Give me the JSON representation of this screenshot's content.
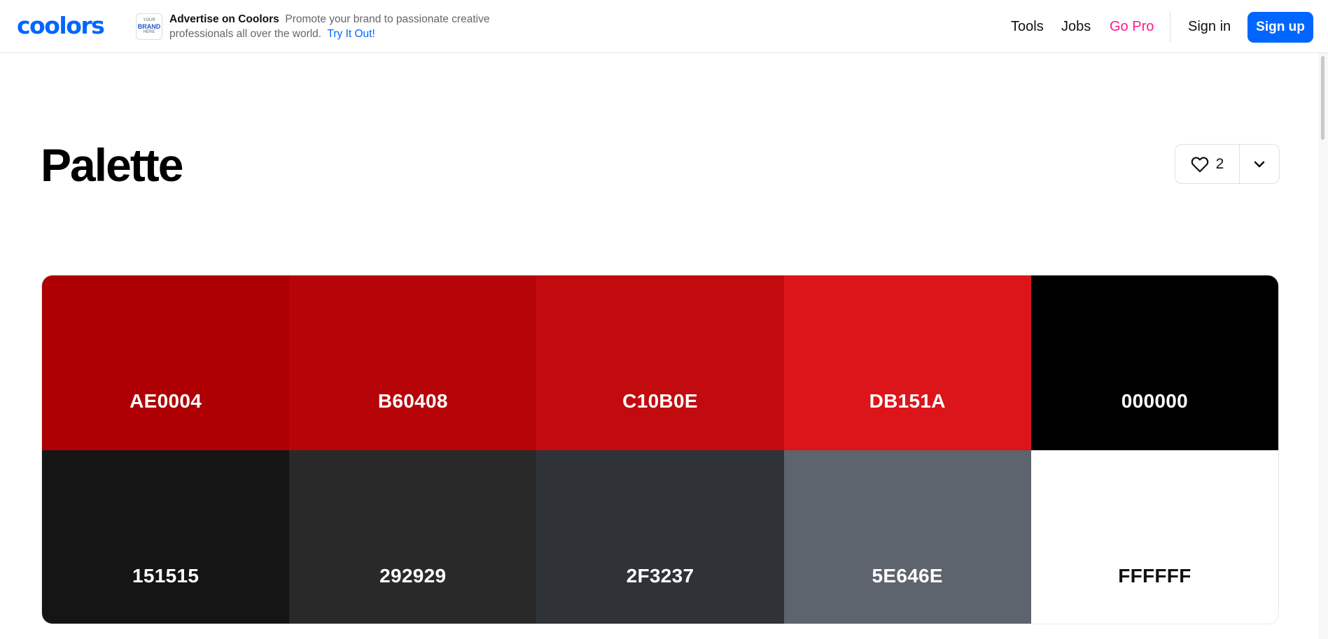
{
  "header": {
    "logo_text": "coolors",
    "ad": {
      "box_small_top": "YOUR",
      "box_big": "BRAND",
      "box_small_bottom": "HERE",
      "title": "Advertise on Coolors",
      "body": "Promote your brand to passionate creative professionals all over the world.",
      "link": "Try It Out!"
    },
    "nav": {
      "tools": "Tools",
      "jobs": "Jobs",
      "go_pro": "Go Pro",
      "sign_in": "Sign in",
      "sign_up": "Sign up"
    }
  },
  "page": {
    "title": "Palette",
    "likes": "2"
  },
  "palette": [
    {
      "hex": "AE0004",
      "color": "#AE0004"
    },
    {
      "hex": "B60408",
      "color": "#B60408"
    },
    {
      "hex": "C10B0E",
      "color": "#C10B0E"
    },
    {
      "hex": "DB151A",
      "color": "#DB151A"
    },
    {
      "hex": "000000",
      "color": "#000000"
    },
    {
      "hex": "151515",
      "color": "#151515"
    },
    {
      "hex": "292929",
      "color": "#292929"
    },
    {
      "hex": "2F3237",
      "color": "#2F3237"
    },
    {
      "hex": "5E646E",
      "color": "#5E646E"
    },
    {
      "hex": "FFFFFF",
      "color": "#FFFFFF"
    }
  ],
  "colors": {
    "brand": "#0066ff",
    "go_pro": "#ff1a8c"
  },
  "icons": [
    "heart-icon",
    "chevron-down-icon"
  ]
}
